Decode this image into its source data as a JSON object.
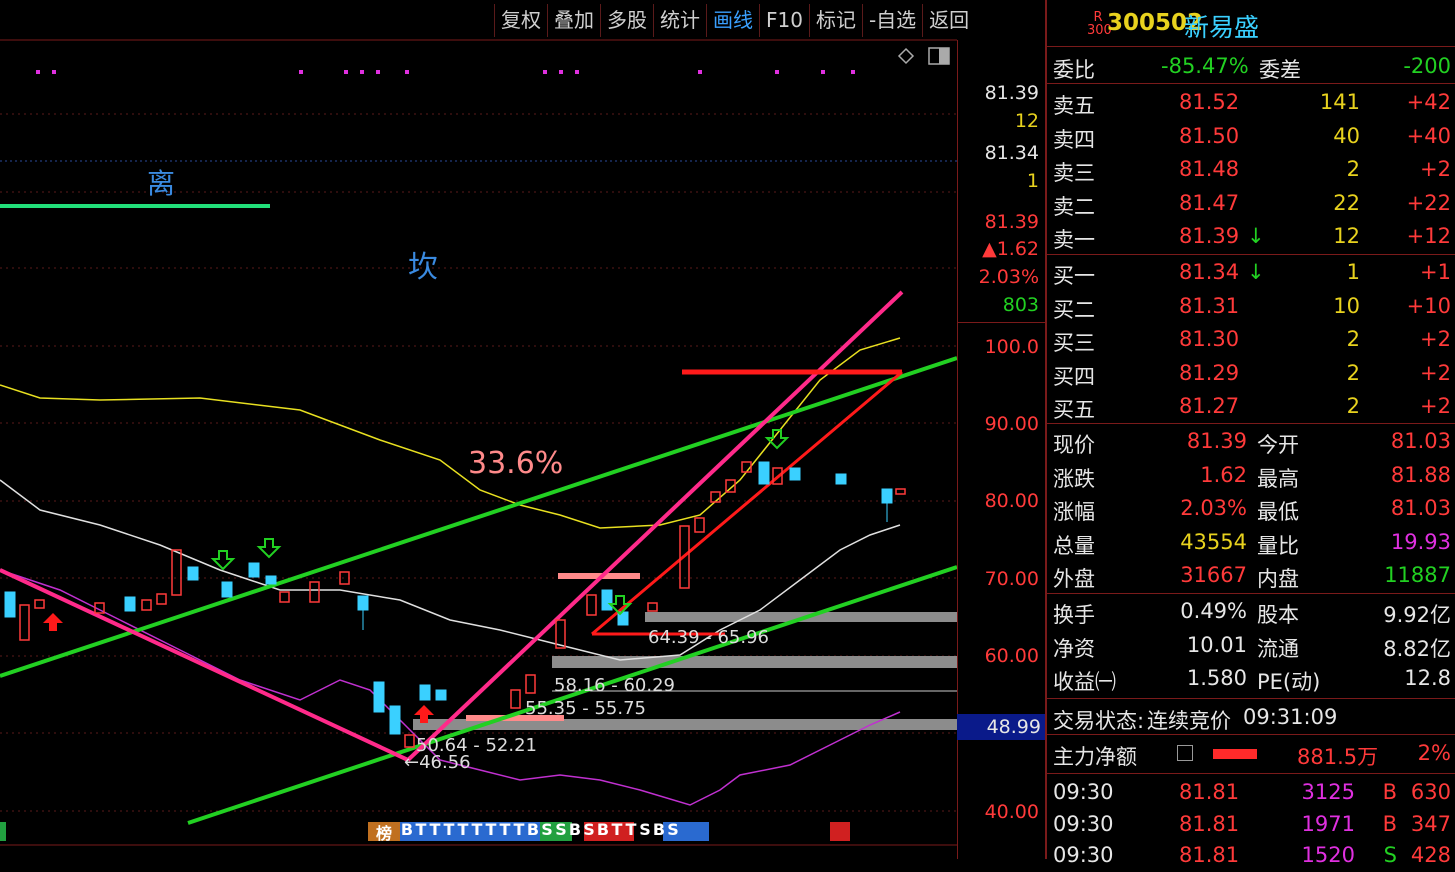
{
  "toolbar": [
    "复权",
    "叠加",
    "多股",
    "统计",
    "画线",
    "F10",
    "标记",
    "-自选",
    "返回"
  ],
  "toolbar_active": "画线",
  "chart": {
    "labels": {
      "li": "离",
      "kan": "坎",
      "pct": "33.6%"
    },
    "zones": [
      "64.39 - 65.96",
      "58.16 - 60.29",
      "55.35 - 55.75",
      "50.64 - 52.21",
      "←46.56"
    ],
    "bottom_marks": [
      "榜",
      "B",
      "T",
      "T",
      "T",
      "T",
      "T",
      "T",
      "T",
      "T",
      "B",
      "S",
      "S",
      "B",
      "S",
      "B",
      "T",
      "T",
      "S",
      "B",
      "S"
    ]
  },
  "axis": {
    "ticks": [
      "100.0",
      "90.00",
      "80.00",
      "70.00",
      "60.00",
      "40.00"
    ],
    "quote": {
      "p1": "81.39",
      "v1": "12",
      "p2": "81.34",
      "v2": "1",
      "price": "81.39",
      "chg": "▲1.62",
      "pct": "2.03%",
      "vol": "803"
    },
    "crosshair_price": "48.99"
  },
  "stock": {
    "badge_top": "R",
    "badge_bottom": "300",
    "code": "300502",
    "name": "新易盛"
  },
  "weibi": {
    "label": "委比",
    "value": "-85.47%",
    "label2": "委差",
    "value2": "-200"
  },
  "sell": [
    {
      "label": "卖五",
      "price": "81.52",
      "vol": "141",
      "chg": "+42"
    },
    {
      "label": "卖四",
      "price": "81.50",
      "vol": "40",
      "chg": "+40"
    },
    {
      "label": "卖三",
      "price": "81.48",
      "vol": "2",
      "chg": "+2"
    },
    {
      "label": "卖二",
      "price": "81.47",
      "vol": "22",
      "chg": "+22"
    },
    {
      "label": "卖一",
      "price": "81.39",
      "vol": "12",
      "chg": "+12",
      "arrow": "↓"
    }
  ],
  "buy": [
    {
      "label": "买一",
      "price": "81.34",
      "vol": "1",
      "chg": "+1",
      "arrow": "↓"
    },
    {
      "label": "买二",
      "price": "81.31",
      "vol": "10",
      "chg": "+10"
    },
    {
      "label": "买三",
      "price": "81.30",
      "vol": "2",
      "chg": "+2"
    },
    {
      "label": "买四",
      "price": "81.29",
      "vol": "2",
      "chg": "+2"
    },
    {
      "label": "买五",
      "price": "81.27",
      "vol": "2",
      "chg": "+2"
    }
  ],
  "stats": [
    {
      "l1": "现价",
      "v1": "81.39",
      "l2": "今开",
      "v2": "81.03"
    },
    {
      "l1": "涨跌",
      "v1": "1.62",
      "l2": "最高",
      "v2": "81.88"
    },
    {
      "l1": "涨幅",
      "v1": "2.03%",
      "l2": "最低",
      "v2": "81.03"
    },
    {
      "l1": "总量",
      "v1": "43554",
      "l2": "量比",
      "v2": "19.93"
    },
    {
      "l1": "外盘",
      "v1": "31667",
      "l2": "内盘",
      "v2": "11887"
    }
  ],
  "stats2": [
    {
      "l1": "换手",
      "v1": "0.49%",
      "l2": "股本",
      "v2": "9.92亿"
    },
    {
      "l1": "净资",
      "v1": "10.01",
      "l2": "流通",
      "v2": "8.82亿"
    },
    {
      "l1": "收益㈠",
      "v1": "1.580",
      "l2": "PE(动)",
      "v2": "12.8"
    }
  ],
  "trade_status": {
    "label": "交易状态:",
    "value": "连续竞价",
    "time": "09:31:09"
  },
  "main_net": {
    "label": "主力净额",
    "value": "881.5万",
    "pct": "2%"
  },
  "ticks": [
    {
      "time": "09:30",
      "price": "81.81",
      "vol": "3125",
      "side": "B",
      "n": "630"
    },
    {
      "time": "09:30",
      "price": "81.81",
      "vol": "1971",
      "side": "B",
      "n": "347"
    },
    {
      "time": "09:30",
      "price": "81.81",
      "vol": "1520",
      "side": "S",
      "n": "428"
    }
  ]
}
